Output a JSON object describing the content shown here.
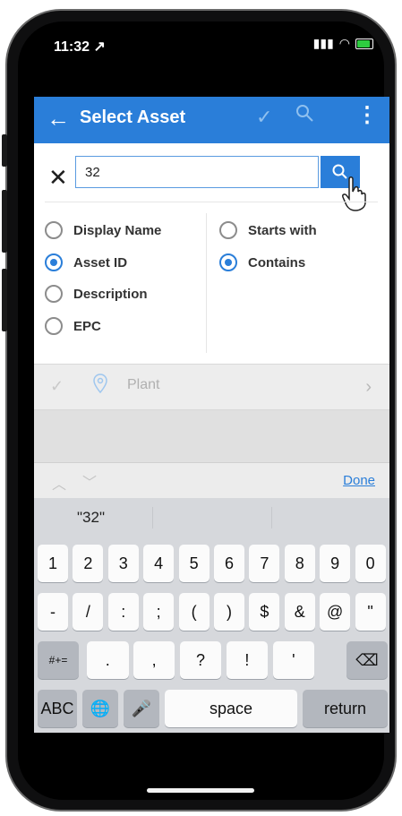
{
  "status": {
    "time": "11:32 ↗"
  },
  "app": {
    "title": "Select Asset",
    "search": {
      "value": "32",
      "placeholder": ""
    },
    "search_by": {
      "options": [
        {
          "label": "Display Name",
          "checked": false
        },
        {
          "label": "Asset ID",
          "checked": true
        },
        {
          "label": "Description",
          "checked": false
        },
        {
          "label": "EPC",
          "checked": false
        }
      ]
    },
    "match_mode": {
      "options": [
        {
          "label": "Starts with",
          "checked": false
        },
        {
          "label": "Contains",
          "checked": true
        }
      ]
    },
    "results": [
      {
        "label": "Plant"
      }
    ]
  },
  "keyboard": {
    "done_label": "Done",
    "suggestion": "\"32\"",
    "row1": [
      "1",
      "2",
      "3",
      "4",
      "5",
      "6",
      "7",
      "8",
      "9",
      "0"
    ],
    "row2": [
      "-",
      "/",
      ":",
      ";",
      "(",
      ")",
      "$",
      "&",
      "@",
      "\""
    ],
    "row3": {
      "left": "#+=",
      "keys": [
        ".",
        ",",
        "?",
        "!",
        "'"
      ],
      "right": "⌫"
    },
    "row4": {
      "abc": "ABC",
      "globe": "🌐",
      "mic": "🎤",
      "space": "space",
      "return": "return"
    }
  },
  "colors": {
    "accent": "#2a7ed9",
    "keyboard_bg": "#d6d8dc"
  }
}
